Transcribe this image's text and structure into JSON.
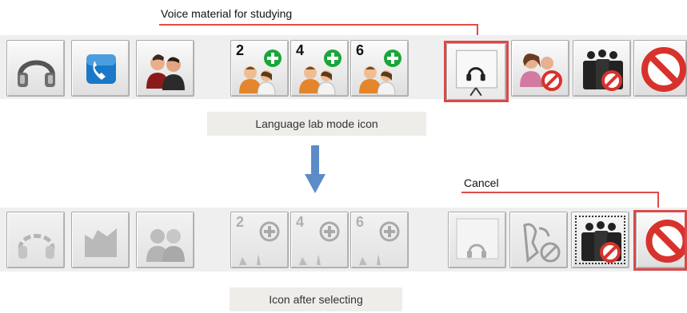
{
  "callouts": {
    "voice_material": "Voice material for studying",
    "cancel": "Cancel"
  },
  "captions": {
    "top": "Language lab mode icon",
    "bottom": "Icon after selecting"
  },
  "top_toolbar": {
    "buttons": [
      {
        "name": "headphones-button",
        "icon": "headphones-icon"
      },
      {
        "name": "phone-button",
        "icon": "phone-icon"
      },
      {
        "name": "pair-talk-button",
        "icon": "two-people-icon"
      },
      {
        "name": "group-2-button",
        "icon": "add-group-icon",
        "count": "2"
      },
      {
        "name": "group-4-button",
        "icon": "add-group-icon",
        "count": "4"
      },
      {
        "name": "group-6-button",
        "icon": "add-group-icon",
        "count": "6"
      },
      {
        "name": "voice-material-button",
        "icon": "headphones-screen-icon"
      },
      {
        "name": "cancel-pair-button",
        "icon": "cancel-pair-icon"
      },
      {
        "name": "cancel-group-button",
        "icon": "cancel-group-icon"
      },
      {
        "name": "cancel-button",
        "icon": "prohibited-icon"
      }
    ]
  },
  "bottom_toolbar": {
    "counts": [
      "2",
      "4",
      "6"
    ]
  },
  "colors": {
    "highlight": "#d94a4a",
    "arrow": "#5b8cc8",
    "plus_green": "#1aa63a",
    "phone_blue": "#1b78c8",
    "prohibit_red": "#d8322c"
  }
}
